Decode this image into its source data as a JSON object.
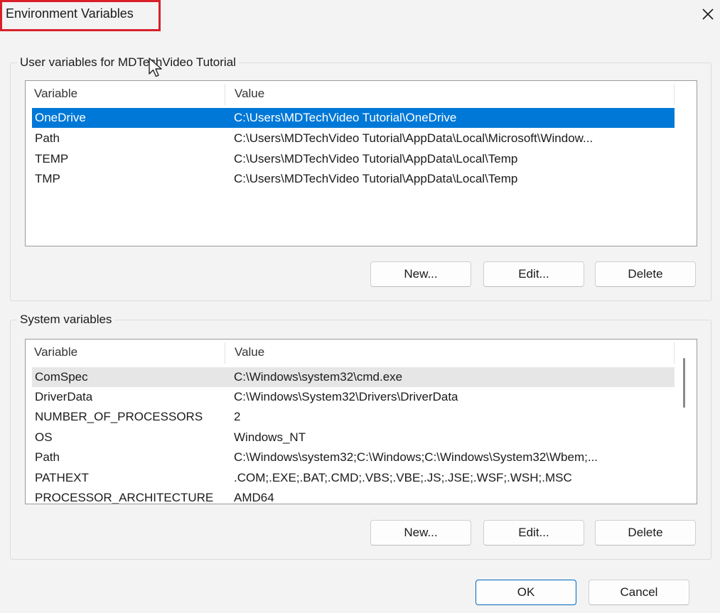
{
  "window": {
    "title": "Environment Variables",
    "close_icon": "close-icon"
  },
  "user_vars": {
    "group_label": "User variables for MDTechVideo Tutorial",
    "header": {
      "variable": "Variable",
      "value": "Value"
    },
    "rows": [
      {
        "variable": "OneDrive",
        "value": "C:\\Users\\MDTechVideo Tutorial\\OneDrive",
        "selected": true
      },
      {
        "variable": "Path",
        "value": "C:\\Users\\MDTechVideo Tutorial\\AppData\\Local\\Microsoft\\Window..."
      },
      {
        "variable": "TEMP",
        "value": "C:\\Users\\MDTechVideo Tutorial\\AppData\\Local\\Temp"
      },
      {
        "variable": "TMP",
        "value": "C:\\Users\\MDTechVideo Tutorial\\AppData\\Local\\Temp"
      }
    ],
    "buttons": {
      "new": "New...",
      "edit": "Edit...",
      "delete": "Delete"
    }
  },
  "system_vars": {
    "group_label": "System variables",
    "header": {
      "variable": "Variable",
      "value": "Value"
    },
    "rows": [
      {
        "variable": "ComSpec",
        "value": "C:\\Windows\\system32\\cmd.exe",
        "hover": true
      },
      {
        "variable": "DriverData",
        "value": "C:\\Windows\\System32\\Drivers\\DriverData"
      },
      {
        "variable": "NUMBER_OF_PROCESSORS",
        "value": "2"
      },
      {
        "variable": "OS",
        "value": "Windows_NT"
      },
      {
        "variable": "Path",
        "value": "C:\\Windows\\system32;C:\\Windows;C:\\Windows\\System32\\Wbem;..."
      },
      {
        "variable": "PATHEXT",
        "value": ".COM;.EXE;.BAT;.CMD;.VBS;.VBE;.JS;.JSE;.WSF;.WSH;.MSC"
      },
      {
        "variable": "PROCESSOR_ARCHITECTURE",
        "value": "AMD64"
      }
    ],
    "buttons": {
      "new": "New...",
      "edit": "Edit...",
      "delete": "Delete"
    }
  },
  "footer": {
    "ok": "OK",
    "cancel": "Cancel"
  },
  "colors": {
    "selection": "#0078d7",
    "highlight_box": "#d8202a",
    "primary_border": "#0067c0"
  }
}
